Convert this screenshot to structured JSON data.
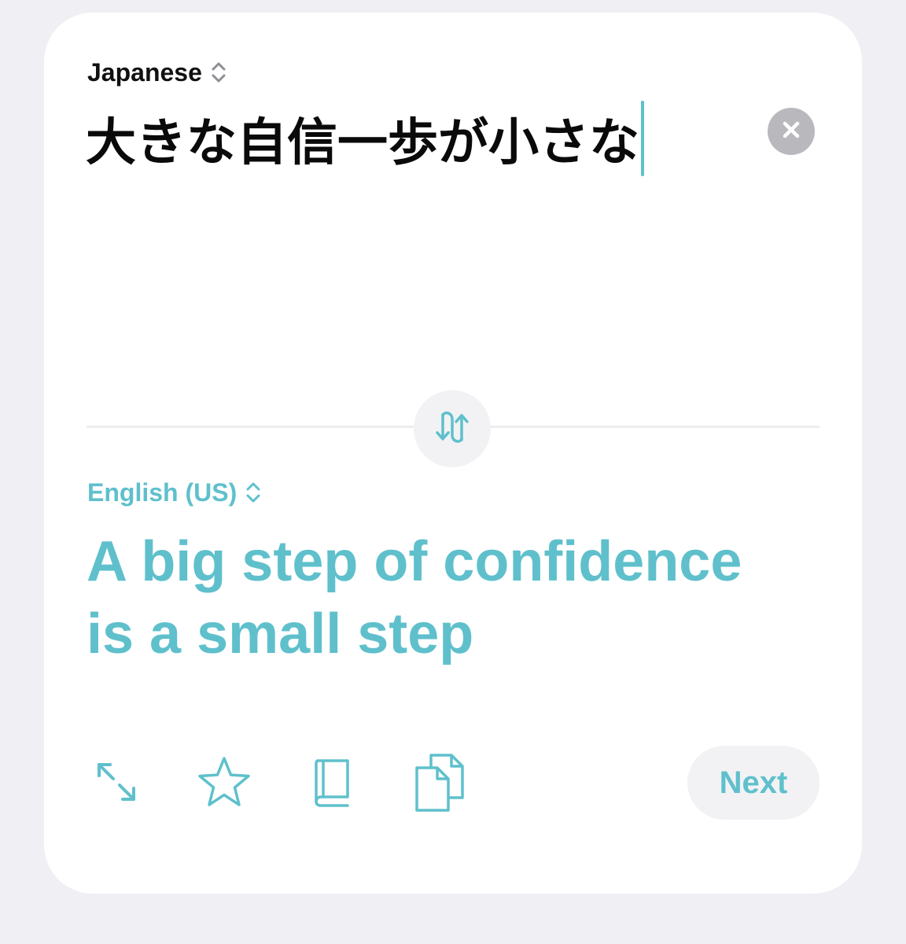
{
  "source": {
    "language": "Japanese",
    "text": "大きな自信一歩が小さな"
  },
  "target": {
    "language": "English (US)",
    "text": "A big step of confidence is a small step"
  },
  "icons": {
    "language_picker": "chevron-up-down-icon",
    "clear": "xmark-circle-icon",
    "swap": "swap-arrows-icon",
    "fullscreen": "expand-arrows-icon",
    "favorite": "star-icon",
    "dictionary": "book-icon",
    "copy": "copy-documents-icon"
  },
  "actions": {
    "next_label": "Next"
  },
  "colors": {
    "accent": "#5fc0cc",
    "background": "#efeff4",
    "card": "#ffffff",
    "clear_button": "#b9b9bd",
    "text_primary": "#0a0a0a"
  }
}
